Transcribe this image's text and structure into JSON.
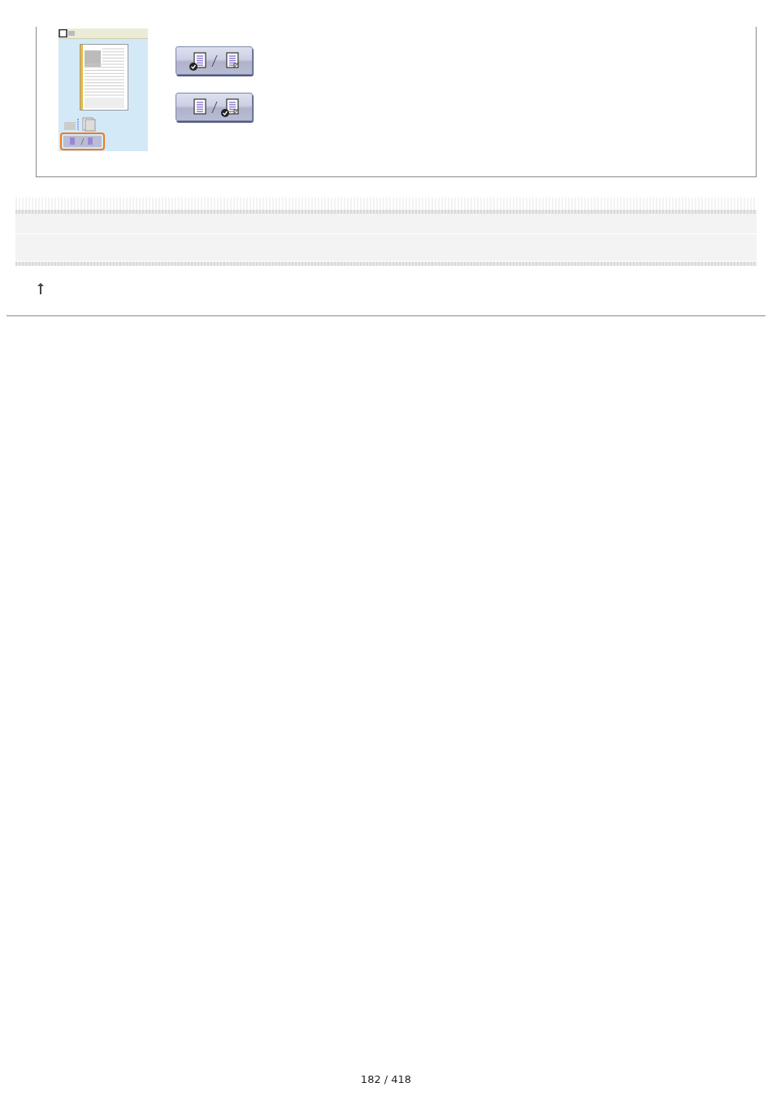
{
  "preview": {
    "highlighted_button": true
  },
  "buttons": [
    {
      "kind": "one-sided"
    },
    {
      "kind": "two-sided"
    }
  ],
  "page_number": "182 / 418"
}
